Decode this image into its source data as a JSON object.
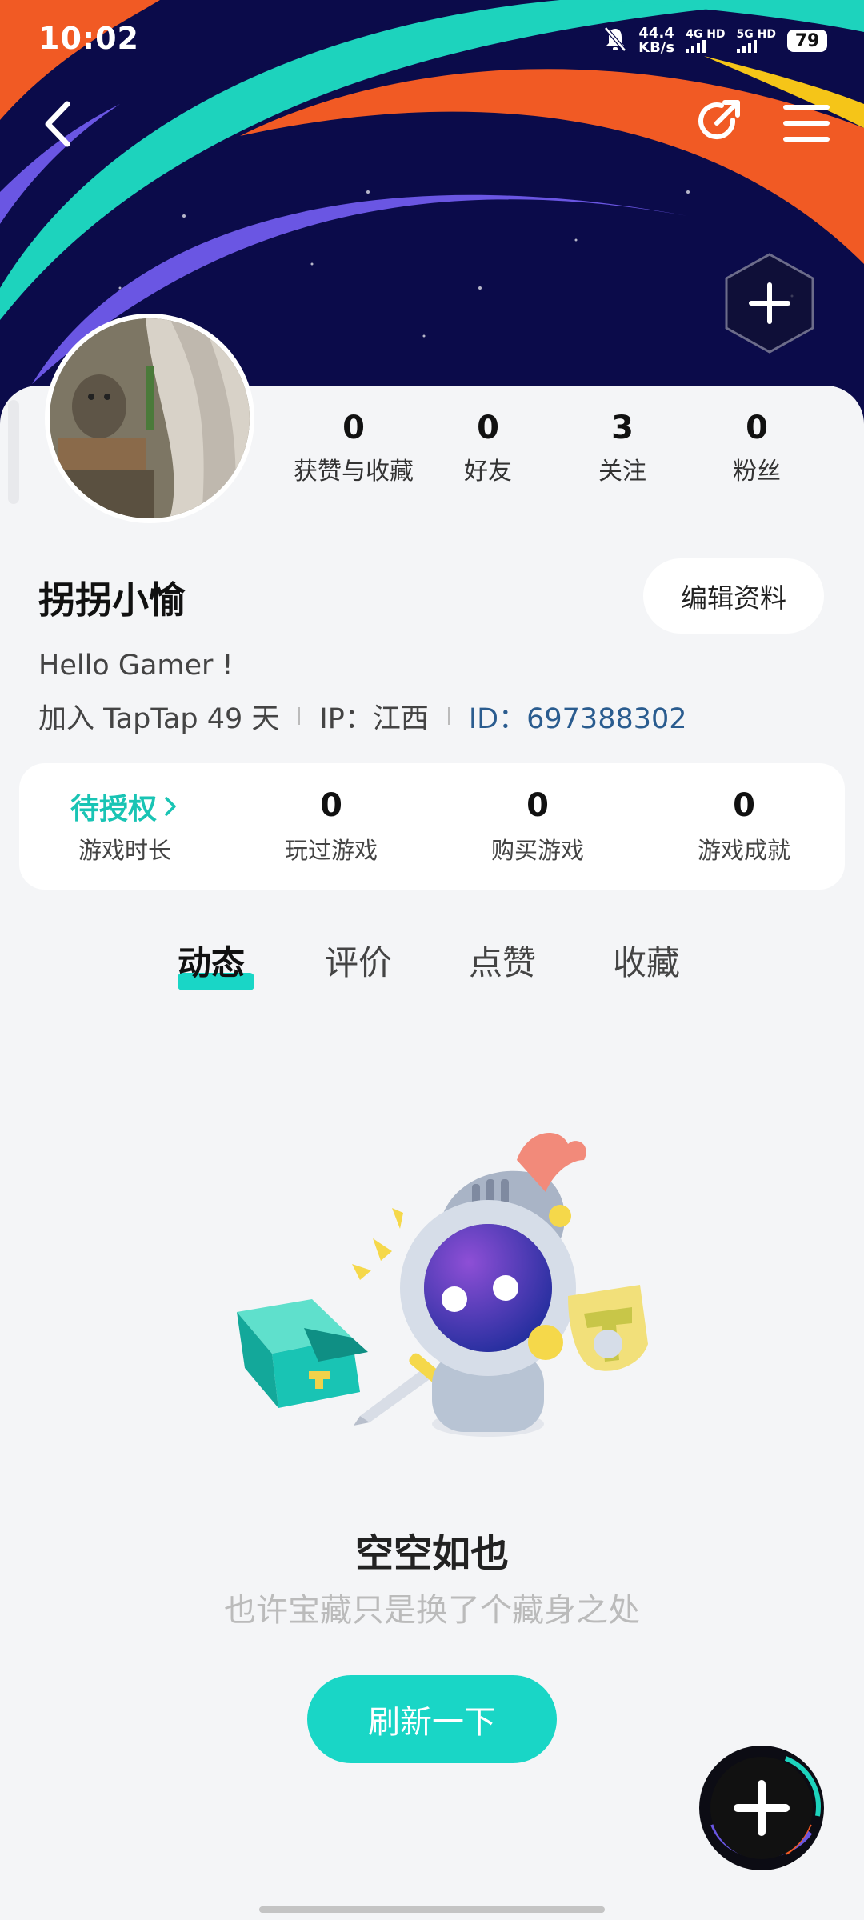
{
  "status_bar": {
    "time": "10:02",
    "net_speed_value": "44.4",
    "net_speed_unit": "KB/s",
    "sim1_label": "4G HD",
    "sim2_label": "5G HD",
    "battery": "79"
  },
  "profile": {
    "stats": [
      {
        "value": "0",
        "label": "获赞与收藏"
      },
      {
        "value": "0",
        "label": "好友"
      },
      {
        "value": "3",
        "label": "关注"
      },
      {
        "value": "0",
        "label": "粉丝"
      }
    ],
    "username": "拐拐小愉",
    "edit_button": "编辑资料",
    "bio": "Hello Gamer !",
    "join_text": "加入 TapTap 49 天",
    "ip_text": "IP：江西",
    "id_text": "ID：697388302"
  },
  "game_stats": [
    {
      "value": "待授权",
      "label": "游戏时长"
    },
    {
      "value": "0",
      "label": "玩过游戏"
    },
    {
      "value": "0",
      "label": "购买游戏"
    },
    {
      "value": "0",
      "label": "游戏成就"
    }
  ],
  "tabs": [
    "动态",
    "评价",
    "点赞",
    "收藏"
  ],
  "active_tab": "动态",
  "empty_state": {
    "title": "空空如也",
    "subtitle": "也许宝藏只是换了个藏身之处",
    "refresh_button": "刷新一下"
  },
  "colors": {
    "accent": "#19d6c6",
    "banner_bg": "#0b0b4a",
    "id_link": "#2a5c8f"
  },
  "icons": [
    "back-arrow-icon",
    "share-icon",
    "menu-icon",
    "add-hexagon-icon",
    "chevron-right-icon",
    "add-fab-icon",
    "bell-off-icon"
  ]
}
